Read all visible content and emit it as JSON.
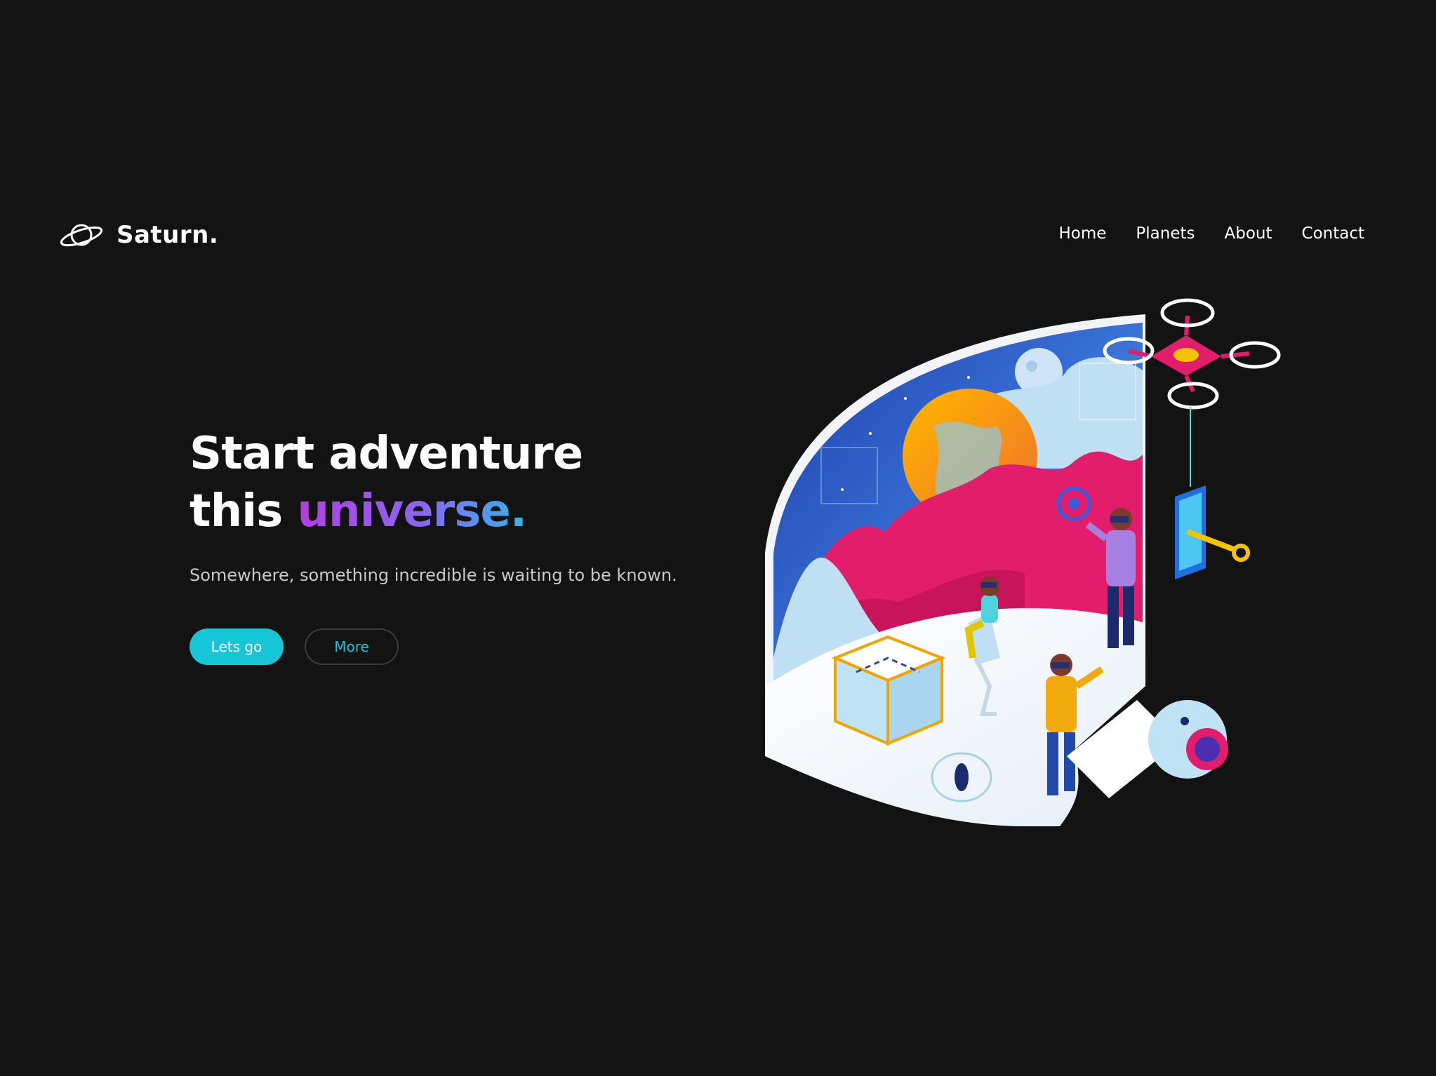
{
  "brand": {
    "name": "Saturn.",
    "icon": "saturn-planet-icon"
  },
  "nav": {
    "items": [
      {
        "label": "Home"
      },
      {
        "label": "Planets"
      },
      {
        "label": "About"
      },
      {
        "label": "Contact"
      }
    ]
  },
  "hero": {
    "headline_line1": "Start adventure",
    "headline_line2_prefix": "this ",
    "headline_accent": "universe.",
    "subtitle": "Somewhere, something incredible is waiting to be known.",
    "primary_button": "Lets go",
    "secondary_button": "More"
  },
  "colors": {
    "background": "#131313",
    "accent_cyan": "#17c6d6",
    "gradient_start": "#b13fe0",
    "gradient_end": "#2fb7e6",
    "text_secondary": "#c9c9c9"
  }
}
